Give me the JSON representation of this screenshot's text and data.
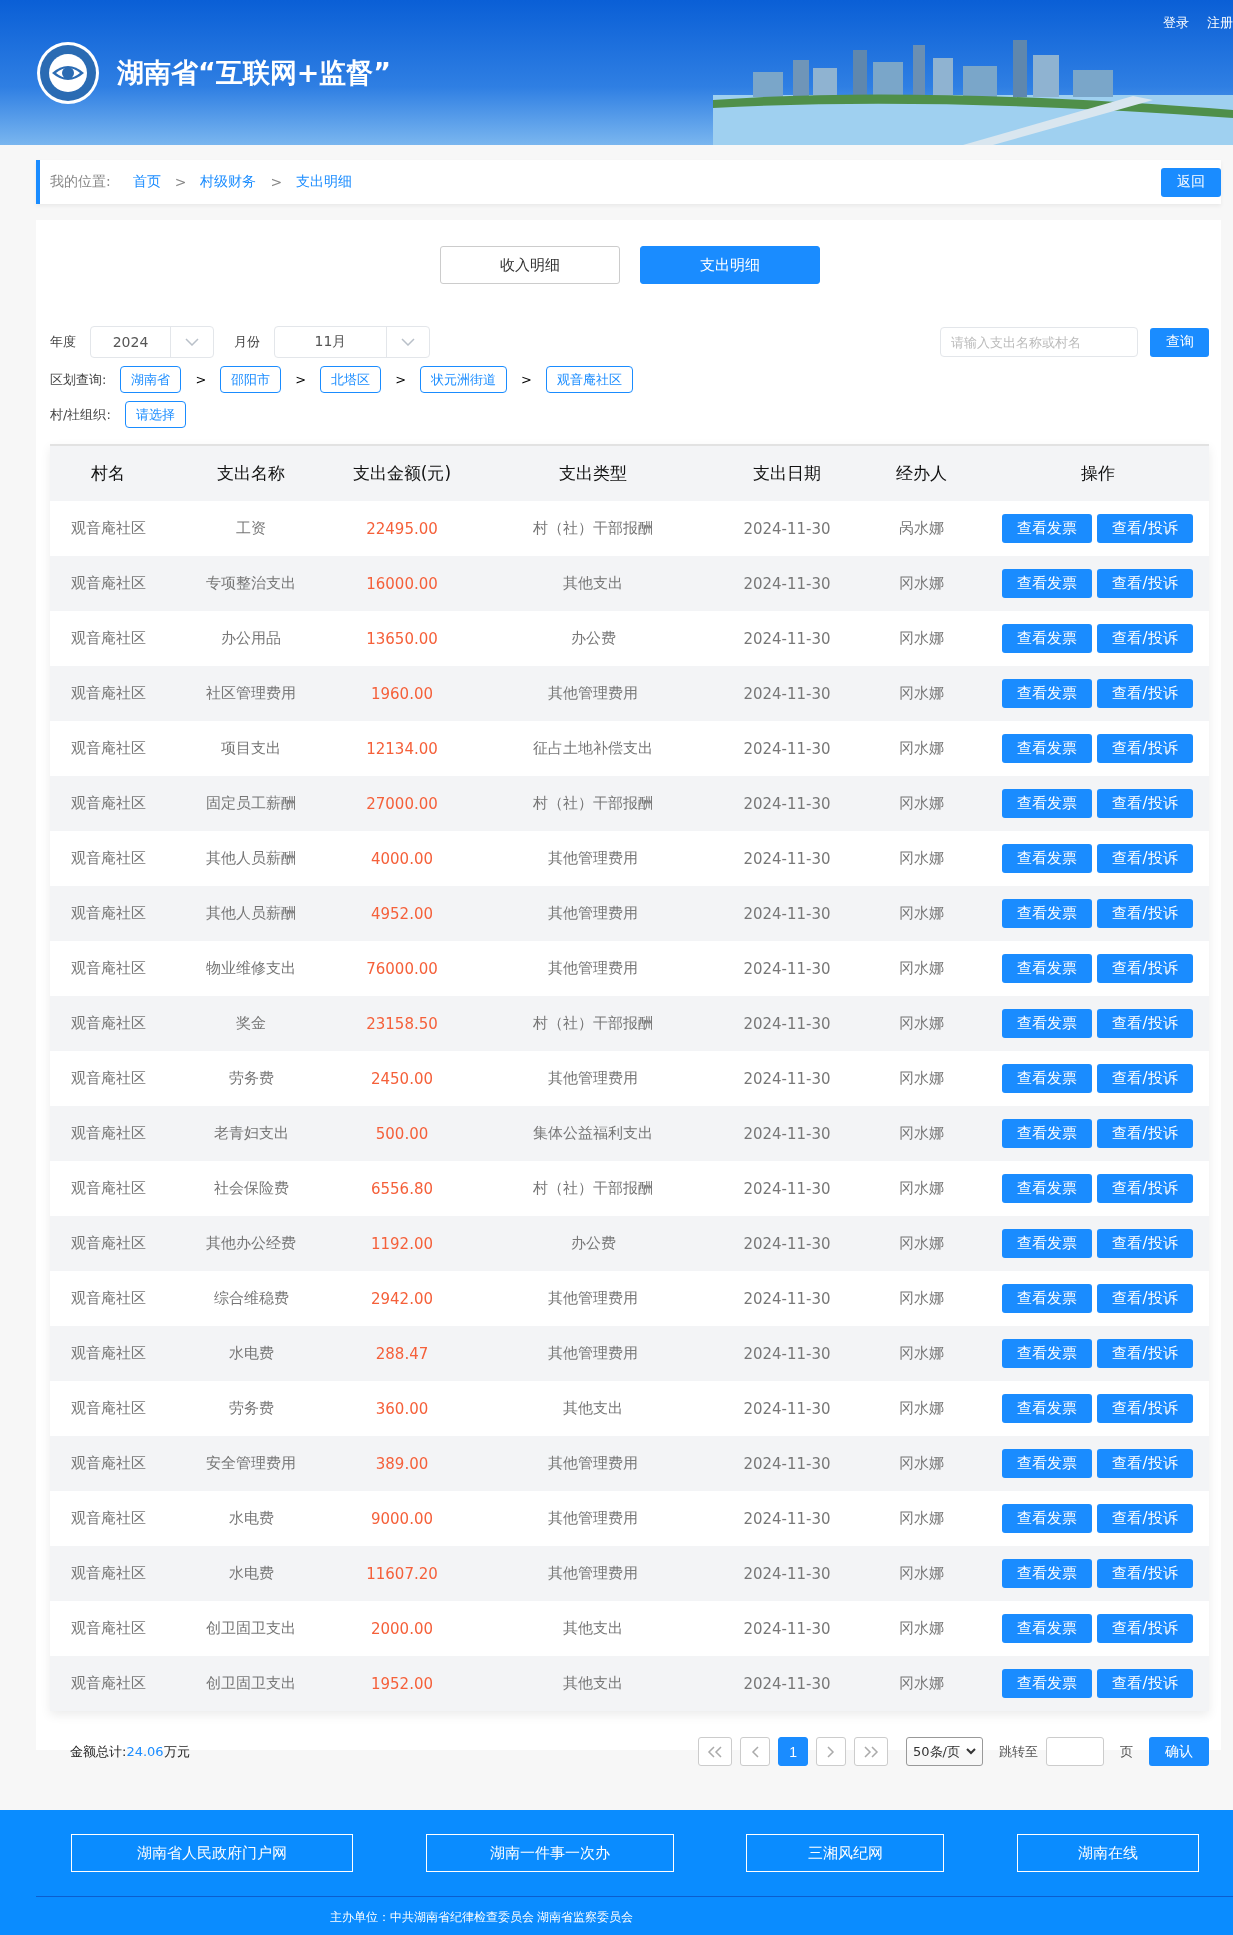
{
  "header": {
    "title": "湖南省“互联网+监督”",
    "links": [
      "登录",
      "注册"
    ]
  },
  "breadcrumb": {
    "label": "我的位置:",
    "items": [
      "首页",
      "村级财务",
      "支出明细"
    ],
    "separator": ">",
    "back": "返回"
  },
  "tabs": [
    {
      "label": "收入明细",
      "selected": false
    },
    {
      "label": "支出明细",
      "selected": true
    }
  ],
  "filters": {
    "year_label": "年度",
    "year": "2024",
    "month_label": "月份",
    "month": "11月",
    "search_placeholder": "请输入支出名称或村名",
    "search_button": "查询",
    "region_label": "区划查询:",
    "regions": [
      "湖南省",
      "邵阳市",
      "北塔区",
      "状元洲街道",
      "观音庵社区"
    ],
    "region_separator": ">",
    "org_label": "村/社组织:",
    "org_button": "请选择"
  },
  "table": {
    "columns": [
      "村名",
      "支出名称",
      "支出金额(元)",
      "支出类型",
      "支出日期",
      "经办人",
      "操作"
    ],
    "rows": [
      {
        "village": "观音庵社区",
        "name": "工资",
        "amount": "22495.00",
        "type": "村（社）干部报酬",
        "date": "2024-11-30",
        "handler": "呙水娜",
        "actions": [
          "查看发票",
          "查看/投诉"
        ]
      },
      {
        "village": "观音庵社区",
        "name": "专项整治支出",
        "amount": "16000.00",
        "type": "其他支出",
        "date": "2024-11-30",
        "handler": "冈水娜",
        "actions": [
          "查看发票",
          "查看/投诉"
        ]
      },
      {
        "village": "观音庵社区",
        "name": "办公用品",
        "amount": "13650.00",
        "type": "办公费",
        "date": "2024-11-30",
        "handler": "冈水娜",
        "actions": [
          "查看发票",
          "查看/投诉"
        ]
      },
      {
        "village": "观音庵社区",
        "name": "社区管理费用",
        "amount": "1960.00",
        "type": "其他管理费用",
        "date": "2024-11-30",
        "handler": "冈水娜",
        "actions": [
          "查看发票",
          "查看/投诉"
        ]
      },
      {
        "village": "观音庵社区",
        "name": "项目支出",
        "amount": "12134.00",
        "type": "征占土地补偿支出",
        "date": "2024-11-30",
        "handler": "冈水娜",
        "actions": [
          "查看发票",
          "查看/投诉"
        ]
      },
      {
        "village": "观音庵社区",
        "name": "固定员工薪酬",
        "amount": "27000.00",
        "type": "村（社）干部报酬",
        "date": "2024-11-30",
        "handler": "冈水娜",
        "actions": [
          "查看发票",
          "查看/投诉"
        ]
      },
      {
        "village": "观音庵社区",
        "name": "其他人员薪酬",
        "amount": "4000.00",
        "type": "其他管理费用",
        "date": "2024-11-30",
        "handler": "冈水娜",
        "actions": [
          "查看发票",
          "查看/投诉"
        ]
      },
      {
        "village": "观音庵社区",
        "name": "其他人员薪酬",
        "amount": "4952.00",
        "type": "其他管理费用",
        "date": "2024-11-30",
        "handler": "冈水娜",
        "actions": [
          "查看发票",
          "查看/投诉"
        ]
      },
      {
        "village": "观音庵社区",
        "name": "物业维修支出",
        "amount": "76000.00",
        "type": "其他管理费用",
        "date": "2024-11-30",
        "handler": "冈水娜",
        "actions": [
          "查看发票",
          "查看/投诉"
        ]
      },
      {
        "village": "观音庵社区",
        "name": "奖金",
        "amount": "23158.50",
        "type": "村（社）干部报酬",
        "date": "2024-11-30",
        "handler": "冈水娜",
        "actions": [
          "查看发票",
          "查看/投诉"
        ]
      },
      {
        "village": "观音庵社区",
        "name": "劳务费",
        "amount": "2450.00",
        "type": "其他管理费用",
        "date": "2024-11-30",
        "handler": "冈水娜",
        "actions": [
          "查看发票",
          "查看/投诉"
        ]
      },
      {
        "village": "观音庵社区",
        "name": "老青妇支出",
        "amount": "500.00",
        "type": "集体公益福利支出",
        "date": "2024-11-30",
        "handler": "冈水娜",
        "actions": [
          "查看发票",
          "查看/投诉"
        ]
      },
      {
        "village": "观音庵社区",
        "name": "社会保险费",
        "amount": "6556.80",
        "type": "村（社）干部报酬",
        "date": "2024-11-30",
        "handler": "冈水娜",
        "actions": [
          "查看发票",
          "查看/投诉"
        ]
      },
      {
        "village": "观音庵社区",
        "name": "其他办公经费",
        "amount": "1192.00",
        "type": "办公费",
        "date": "2024-11-30",
        "handler": "冈水娜",
        "actions": [
          "查看发票",
          "查看/投诉"
        ]
      },
      {
        "village": "观音庵社区",
        "name": "综合维稳费",
        "amount": "2942.00",
        "type": "其他管理费用",
        "date": "2024-11-30",
        "handler": "冈水娜",
        "actions": [
          "查看发票",
          "查看/投诉"
        ]
      },
      {
        "village": "观音庵社区",
        "name": "水电费",
        "amount": "288.47",
        "type": "其他管理费用",
        "date": "2024-11-30",
        "handler": "冈水娜",
        "actions": [
          "查看发票",
          "查看/投诉"
        ]
      },
      {
        "village": "观音庵社区",
        "name": "劳务费",
        "amount": "360.00",
        "type": "其他支出",
        "date": "2024-11-30",
        "handler": "冈水娜",
        "actions": [
          "查看发票",
          "查看/投诉"
        ]
      },
      {
        "village": "观音庵社区",
        "name": "安全管理费用",
        "amount": "389.00",
        "type": "其他管理费用",
        "date": "2024-11-30",
        "handler": "冈水娜",
        "actions": [
          "查看发票",
          "查看/投诉"
        ]
      },
      {
        "village": "观音庵社区",
        "name": "水电费",
        "amount": "9000.00",
        "type": "其他管理费用",
        "date": "2024-11-30",
        "handler": "冈水娜",
        "actions": [
          "查看发票",
          "查看/投诉"
        ]
      },
      {
        "village": "观音庵社区",
        "name": "水电费",
        "amount": "11607.20",
        "type": "其他管理费用",
        "date": "2024-11-30",
        "handler": "冈水娜",
        "actions": [
          "查看发票",
          "查看/投诉"
        ]
      },
      {
        "village": "观音庵社区",
        "name": "创卫固卫支出",
        "amount": "2000.00",
        "type": "其他支出",
        "date": "2024-11-30",
        "handler": "冈水娜",
        "actions": [
          "查看发票",
          "查看/投诉"
        ]
      },
      {
        "village": "观音庵社区",
        "name": "创卫固卫支出",
        "amount": "1952.00",
        "type": "其他支出",
        "date": "2024-11-30",
        "handler": "冈水娜",
        "actions": [
          "查看发票",
          "查看/投诉"
        ]
      }
    ]
  },
  "summary": {
    "label": "金额总计:",
    "value": "24.06",
    "unit": "万元"
  },
  "pagination": {
    "pages": [
      {
        "label": "1",
        "selected": true
      }
    ],
    "page_size": "50条/页",
    "jump_label": "跳转至",
    "page_unit": "页",
    "confirm": "确认"
  },
  "footer": {
    "links": [
      "湖南省人民政府门户网",
      "湖南一件事一次办",
      "三湘风纪网",
      "湖南在线"
    ],
    "sponsor": "主办单位：中共湖南省纪律检查委员会 湖南省监察委员会"
  }
}
